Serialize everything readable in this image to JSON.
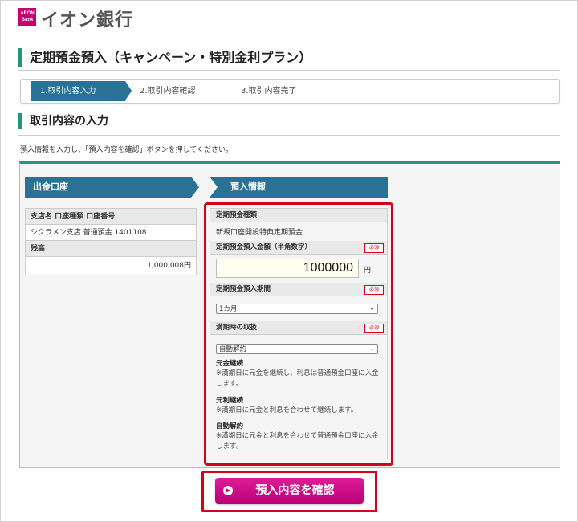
{
  "header": {
    "logo_mark_top": "AEON",
    "logo_mark_bottom": "Bank",
    "logo_text": "イオン銀行"
  },
  "page_title": "定期預金預入（キャンペーン・特別金利プラン）",
  "steps": [
    "1.取引内容入力",
    "2.取引内容確認",
    "3.取引内容完了"
  ],
  "section_title": "取引内容の入力",
  "instruction": "預入情報を入力し、「預入内容を確認」ボタンを押してください。",
  "withdrawal": {
    "title": "出金口座",
    "account_header": "支店名 口座種類 口座番号",
    "account_value": "シクラメン支店 普通預金 1401108",
    "balance_label": "残高",
    "balance_value": "1,000,008円"
  },
  "deposit": {
    "title": "預入情報",
    "type_label": "定期預金種類",
    "type_value": "新規口座開設特典定期預金",
    "amount_label": "定期預金預入金額（半角数字）",
    "amount_value": "1000000",
    "amount_unit": "円",
    "required_label": "必須",
    "period_label": "定期預金預入期間",
    "period_value": "1カ月",
    "maturity_label": "満期時の取扱",
    "maturity_value": "自動解約",
    "notes": [
      {
        "title": "元金継続",
        "text": "※満期日に元金を継続し、利息は普通預金口座に入金します。"
      },
      {
        "title": "元利継続",
        "text": "※満期日に元金と利息を合わせて継続します。"
      },
      {
        "title": "自動解約",
        "text": "※満期日に元金と利息を合わせて普通預金口座に入金します。"
      }
    ]
  },
  "submit_label": "預入内容を確認",
  "colors": {
    "brand": "#c8006f",
    "accent": "#23967f",
    "band": "#2a7196",
    "alert": "#d6001c"
  }
}
